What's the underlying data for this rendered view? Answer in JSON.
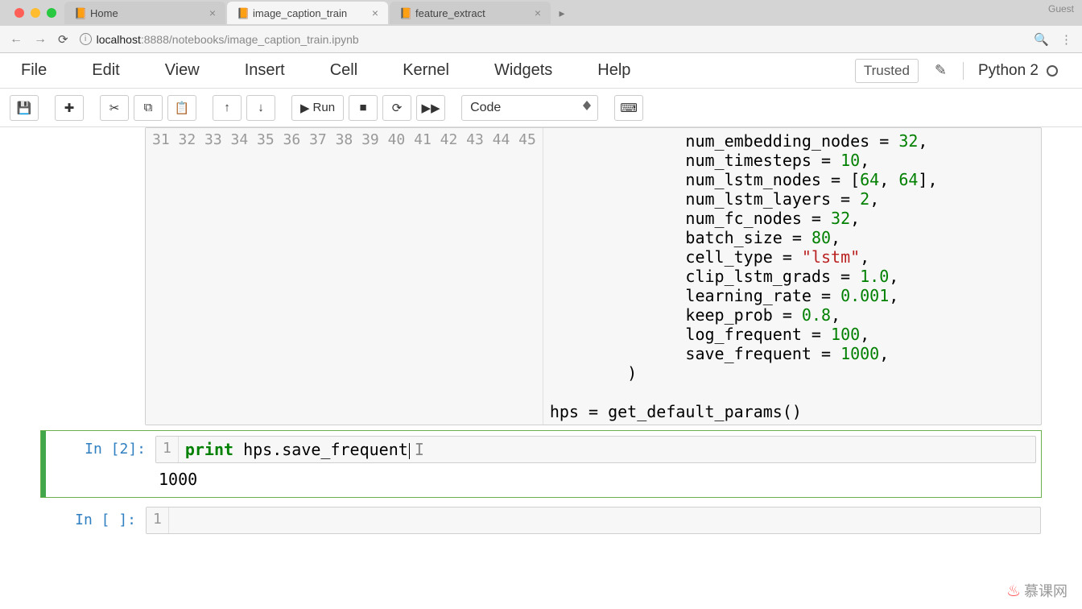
{
  "browser": {
    "guest_label": "Guest",
    "tabs": [
      {
        "title": "Home",
        "active": false
      },
      {
        "title": "image_caption_train",
        "active": true
      },
      {
        "title": "feature_extract",
        "active": false
      }
    ],
    "url_host": "localhost",
    "url_port": ":8888",
    "url_path": "/notebooks/image_caption_train.ipynb"
  },
  "menubar": {
    "file": "File",
    "edit": "Edit",
    "view": "View",
    "insert": "Insert",
    "cell": "Cell",
    "kernel": "Kernel",
    "widgets": "Widgets",
    "help": "Help",
    "trusted": "Trusted",
    "kernel_name": "Python 2"
  },
  "toolbar": {
    "run_label": "Run",
    "celltype": "Code"
  },
  "cell1": {
    "gutter": [
      "31",
      "32",
      "33",
      "34",
      "35",
      "36",
      "37",
      "38",
      "39",
      "40",
      "41",
      "42",
      "43",
      "44",
      "45"
    ],
    "lines": [
      {
        "indent": "              ",
        "key": "num_embedding_nodes",
        "eq": " = ",
        "val": "32",
        "suffix": ",",
        "vtype": "num"
      },
      {
        "indent": "              ",
        "key": "num_timesteps",
        "eq": " = ",
        "val": "10",
        "suffix": ",",
        "vtype": "num"
      },
      {
        "indent": "              ",
        "key": "num_lstm_nodes",
        "eq": " = [",
        "val": "64",
        "mid": ", ",
        "val2": "64",
        "suffix": "],",
        "vtype": "num"
      },
      {
        "indent": "              ",
        "key": "num_lstm_layers",
        "eq": " = ",
        "val": "2",
        "suffix": ",",
        "vtype": "num"
      },
      {
        "indent": "              ",
        "key": "num_fc_nodes",
        "eq": " = ",
        "val": "32",
        "suffix": ",",
        "vtype": "num"
      },
      {
        "indent": "              ",
        "key": "batch_size",
        "eq": " = ",
        "val": "80",
        "suffix": ",",
        "vtype": "num"
      },
      {
        "indent": "              ",
        "key": "cell_type",
        "eq": " = ",
        "val": "\"lstm\"",
        "suffix": ",",
        "vtype": "str"
      },
      {
        "indent": "              ",
        "key": "clip_lstm_grads",
        "eq": " = ",
        "val": "1.0",
        "suffix": ",",
        "vtype": "num"
      },
      {
        "indent": "              ",
        "key": "learning_rate",
        "eq": " = ",
        "val": "0.001",
        "suffix": ",",
        "vtype": "num"
      },
      {
        "indent": "              ",
        "key": "keep_prob",
        "eq": " = ",
        "val": "0.8",
        "suffix": ",",
        "vtype": "num"
      },
      {
        "indent": "              ",
        "key": "log_frequent",
        "eq": " = ",
        "val": "100",
        "suffix": ",",
        "vtype": "num"
      },
      {
        "indent": "              ",
        "key": "save_frequent",
        "eq": " = ",
        "val": "1000",
        "suffix": ",",
        "vtype": "num"
      },
      {
        "raw": "        )"
      },
      {
        "raw": ""
      },
      {
        "raw": "hps = get_default_params()"
      }
    ]
  },
  "cell2": {
    "prompt": "In [2]:",
    "gutter": "1",
    "kw": "print",
    "rest": " hps.save_frequent",
    "output": "1000"
  },
  "cell3": {
    "prompt": "In [ ]:",
    "gutter": "1"
  },
  "watermark": "慕课网"
}
